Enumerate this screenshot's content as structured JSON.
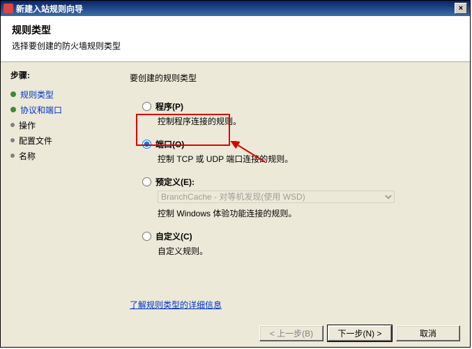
{
  "titlebar": {
    "title": "新建入站规则向导",
    "close": "×"
  },
  "header": {
    "title": "规则类型",
    "subtitle": "选择要创建的防火墙规则类型"
  },
  "sidebar": {
    "steps_label": "步骤:",
    "items": [
      {
        "label": "规则类型"
      },
      {
        "label": "协议和端口"
      },
      {
        "label": "操作"
      },
      {
        "label": "配置文件"
      },
      {
        "label": "名称"
      }
    ]
  },
  "main": {
    "section_title": "要创建的规则类型",
    "options": {
      "program": {
        "label": "程序(P)",
        "desc": "控制程序连接的规则。"
      },
      "port": {
        "label": "端口(O)",
        "desc": "控制 TCP 或 UDP 端口连接的规则。"
      },
      "predefined": {
        "label": "预定义(E):",
        "select_value": "BranchCache - 对等机发现(使用 WSD)",
        "desc": "控制 Windows 体验功能连接的规则。"
      },
      "custom": {
        "label": "自定义(C)",
        "desc": "自定义规则。"
      }
    },
    "learn_more": "了解规则类型的详细信息"
  },
  "footer": {
    "back": "< 上一步(B)",
    "next": "下一步(N) >",
    "cancel": "取消"
  }
}
